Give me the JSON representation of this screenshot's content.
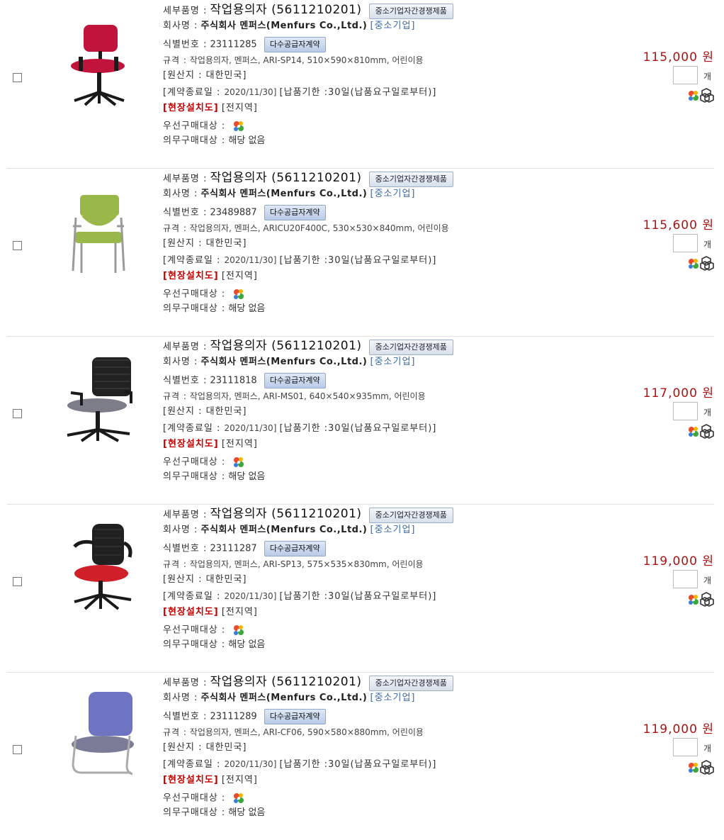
{
  "labels": {
    "detail": "세부품명 :",
    "company": "회사명 :",
    "id": "식별번호 :",
    "spec": "규격 :",
    "origin": "[원산지 : 대한민국]",
    "contract_end": "[계약종료일 : ",
    "delivery": "[납품기한 :30일(납품요구일로부터)]",
    "install": "[현장설치도]",
    "region": "[전지역]",
    "pref": "우선구매대상 :",
    "mand": "의무구매대상 :",
    "mand_value": "해당 없음",
    "qty_unit": "개",
    "won": "원"
  },
  "products": [
    {
      "name": "작업용의자 (5611210201)",
      "badge_competition": "중소기업자간경쟁제품",
      "company": "주식회사 멘퍼스(Menfurs Co.,Ltd.)",
      "company_type": "[중소기업]",
      "id": "23111285",
      "badge_contract": "다수공급자계약",
      "spec": "작업용의자, 멘퍼스, ARI-SP14, 510×590×810mm, 어린이용",
      "contract_end": "2020/11/30]",
      "price": "115,000",
      "chair": "red-task",
      "chair_colors": {
        "seat": "#c0143c",
        "frame": "#1a1a1a"
      }
    },
    {
      "name": "작업용의자 (5611210201)",
      "badge_competition": "중소기업자간경쟁제품",
      "company": "주식회사 멘퍼스(Menfurs Co.,Ltd.)",
      "company_type": "[중소기업]",
      "id": "23489887",
      "badge_contract": "다수공급자계약",
      "spec": "작업용의자, 멘퍼스, ARICU20F400C, 530×530×840mm, 어린이용",
      "contract_end": "2020/11/30]",
      "price": "115,600",
      "chair": "green-stack",
      "chair_colors": {
        "seat": "#9ab84a",
        "frame": "#9a9a9a"
      }
    },
    {
      "name": "작업용의자 (5611210201)",
      "badge_competition": "중소기업자간경쟁제품",
      "company": "주식회사 멘퍼스(Menfurs Co.,Ltd.)",
      "company_type": "[중소기업]",
      "id": "23111818",
      "badge_contract": "다수공급자계약",
      "spec": "작업용의자, 멘퍼스, ARI-MS01, 640×540×935mm, 어린이용",
      "contract_end": "2020/11/30]",
      "price": "117,000",
      "chair": "mesh-grey",
      "chair_colors": {
        "seat": "#7d7d8a",
        "frame": "#1a1a1a"
      }
    },
    {
      "name": "작업용의자 (5611210201)",
      "badge_competition": "중소기업자간경쟁제품",
      "company": "주식회사 멘퍼스(Menfurs Co.,Ltd.)",
      "company_type": "[중소기업]",
      "id": "23111287",
      "badge_contract": "다수공급자계약",
      "spec": "작업용의자, 멘퍼스, ARI-SP13, 575×535×830mm, 어린이용",
      "contract_end": "2020/11/30]",
      "price": "119,000",
      "chair": "mesh-red",
      "chair_colors": {
        "seat": "#d0202a",
        "frame": "#1a1a1a"
      }
    },
    {
      "name": "작업용의자 (5611210201)",
      "badge_competition": "중소기업자간경쟁제품",
      "company": "주식회사 멘퍼스(Menfurs Co.,Ltd.)",
      "company_type": "[중소기업]",
      "id": "23111289",
      "badge_contract": "다수공급자계약",
      "spec": "작업용의자, 멘퍼스, ARI-CF06, 590×580×880mm, 어린이용",
      "contract_end": "2020/11/30]",
      "price": "119,000",
      "chair": "cantilever-blue",
      "chair_colors": {
        "seat": "#7a7b96",
        "back": "#6f74c2",
        "frame": "#aaaaaa"
      }
    }
  ]
}
